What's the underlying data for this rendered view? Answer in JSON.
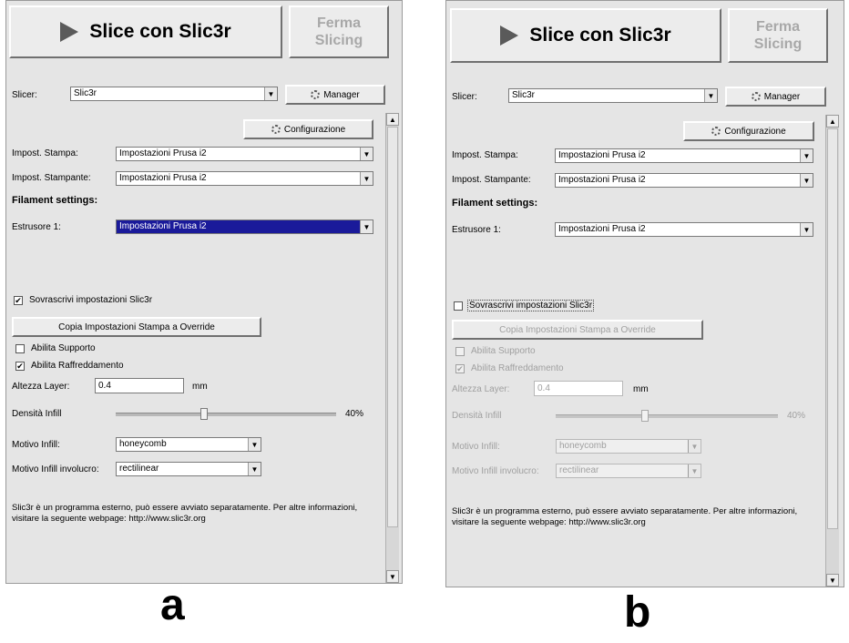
{
  "panels": [
    {
      "slice_button": "Slice con Slic3r",
      "stop_button_line1": "Ferma",
      "stop_button_line2": "Slicing",
      "slicer_label": "Slicer:",
      "slicer_value": "Slic3r",
      "manager_button": "Manager",
      "config_button": "Configurazione",
      "print_label": "Impost. Stampa:",
      "print_value": "Impostazioni Prusa i2",
      "printer_label": "Impost. Stampante:",
      "printer_value": "Impostazioni Prusa i2",
      "filament_title": "Filament settings:",
      "extruder_label": "Estrusore 1:",
      "extruder_value": "Impostazioni Prusa i2",
      "override_label": "Sovrascrivi impostazioni Slic3r",
      "override_checked": true,
      "copy_button": "Copia Impostazioni Stampa a Override",
      "support_label": "Abilita Supporto",
      "support_checked": false,
      "cooling_label": "Abilita Raffreddamento",
      "cooling_checked": true,
      "layer_label": "Altezza Layer:",
      "layer_value": "0.4",
      "layer_unit": "mm",
      "infill_density_label": "Densità Infill",
      "infill_density_value": "40%",
      "infill_density_fraction": 0.4,
      "infill_pattern_label": "Motivo Infill:",
      "infill_pattern_value": "honeycomb",
      "shell_pattern_label": "Motivo Infill involucro:",
      "shell_pattern_value": "rectilinear",
      "info_text": "Slic3r è un programma esterno, può essere avviato separatamente. Per altre informazioni, visitare la seguente webpage: http://www.slic3r.org",
      "caption": "a"
    },
    {
      "slice_button": "Slice con Slic3r",
      "stop_button_line1": "Ferma",
      "stop_button_line2": "Slicing",
      "slicer_label": "Slicer:",
      "slicer_value": "Slic3r",
      "manager_button": "Manager",
      "config_button": "Configurazione",
      "print_label": "Impost. Stampa:",
      "print_value": "Impostazioni Prusa i2",
      "printer_label": "Impost. Stampante:",
      "printer_value": "Impostazioni Prusa i2",
      "filament_title": "Filament settings:",
      "extruder_label": "Estrusore 1:",
      "extruder_value": "Impostazioni Prusa i2",
      "override_label": "Sovrascrivi impostazioni Slic3r",
      "override_checked": false,
      "copy_button": "Copia Impostazioni Stampa a Override",
      "support_label": "Abilita Supporto",
      "support_checked": false,
      "cooling_label": "Abilita Raffreddamento",
      "cooling_checked": true,
      "layer_label": "Altezza Layer:",
      "layer_value": "0.4",
      "layer_unit": "mm",
      "infill_density_label": "Densità Infill",
      "infill_density_value": "40%",
      "infill_density_fraction": 0.4,
      "infill_pattern_label": "Motivo Infill:",
      "infill_pattern_value": "honeycomb",
      "shell_pattern_label": "Motivo Infill involucro:",
      "shell_pattern_value": "rectilinear",
      "info_text": "Slic3r è un programma esterno, può essere avviato separatamente. Per altre informazioni, visitare la seguente webpage: http://www.slic3r.org",
      "caption": "b"
    }
  ]
}
